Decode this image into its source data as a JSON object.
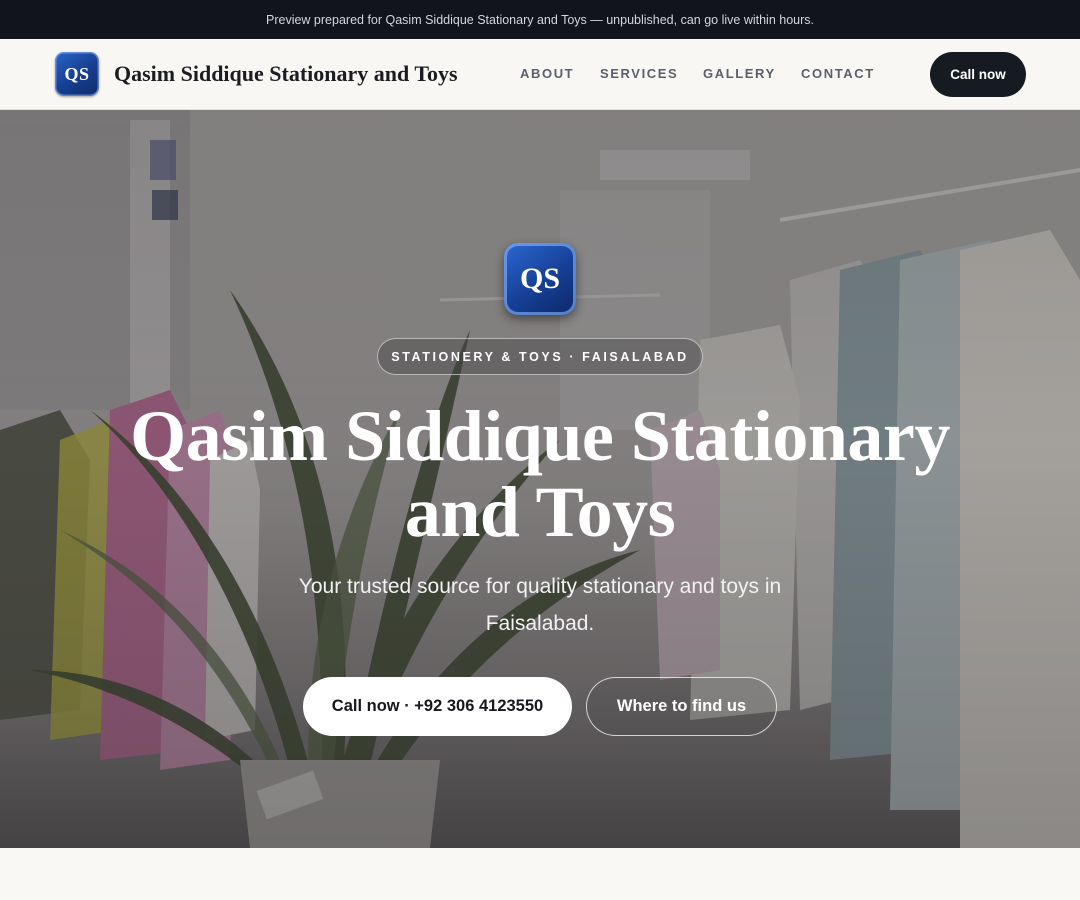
{
  "announcement": "Preview prepared for Qasim Siddique Stationary and Toys — unpublished, can go live within hours.",
  "brand": {
    "initials": "QS",
    "name": "Qasim Siddique Stationary and Toys",
    "badge_color": "#1a4aa8"
  },
  "nav": {
    "links": [
      "ABOUT",
      "SERVICES",
      "GALLERY",
      "CONTACT"
    ],
    "cta": "Call now"
  },
  "hero": {
    "initials": "QS",
    "eyebrow": "STATIONERY & TOYS · FAISALABAD",
    "title_line1": "Qasim Siddique Stationary",
    "title_line2": "and Toys",
    "subtitle": "Your trusted source for quality stationary and toys in Faisalabad.",
    "primary_button": "Call now · +92 306 4123550",
    "secondary_button": "Where to find us",
    "background_image": "store-interior-clothing-racks-plant"
  },
  "colors": {
    "topbar": "#11141a",
    "nav_bg": "#f8f7f4",
    "dark_button": "#161a21",
    "page_bg": "#f9f8f5"
  }
}
